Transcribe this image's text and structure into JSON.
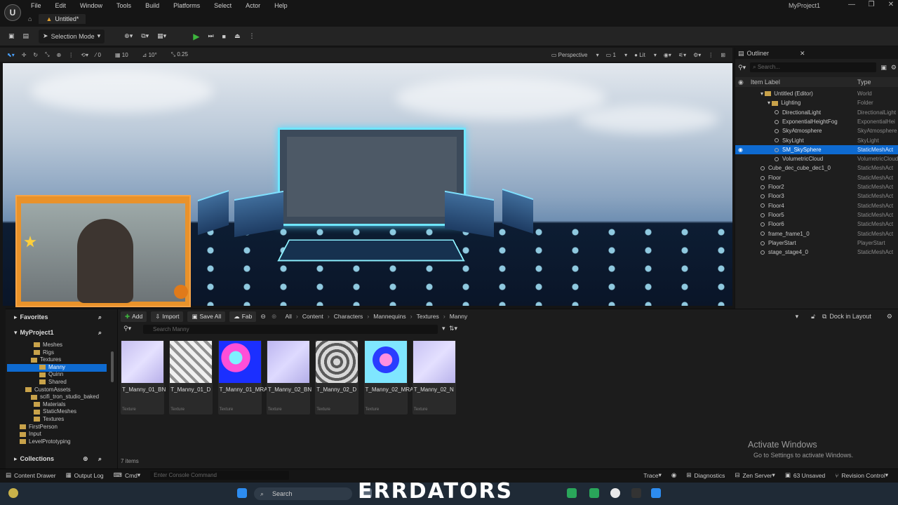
{
  "window": {
    "logo": "U",
    "project_name": "MyProject1",
    "doc_tab": "Untitled*",
    "controls": [
      "—",
      "❐",
      "✕"
    ]
  },
  "menu": [
    "File",
    "Edit",
    "Window",
    "Tools",
    "Build",
    "Platforms",
    "Select",
    "Actor",
    "Help"
  ],
  "toolbar": {
    "selection_mode": "Selection Mode"
  },
  "viewport_toolbar": {
    "snap_move": "10",
    "snap_rotate": "10°",
    "snap_scale": "0.25",
    "view_value": "0",
    "perspective": "Perspective",
    "view_count": "1",
    "lit": "Lit"
  },
  "outliner": {
    "tab": "Outliner",
    "search_placeholder": "Search...",
    "col_label": "Item Label",
    "col_type": "Type",
    "rows": [
      {
        "name": "Untitled (Editor)",
        "type": "World"
      },
      {
        "name": "Lighting",
        "type": "Folder"
      },
      {
        "name": "DirectionalLight",
        "type": "DirectionalLight"
      },
      {
        "name": "ExponentialHeightFog",
        "type": "ExponentialHei"
      },
      {
        "name": "SkyAtmosphere",
        "type": "SkyAtmosphere"
      },
      {
        "name": "SkyLight",
        "type": "SkyLight"
      },
      {
        "name": "SM_SkySphere",
        "type": "StaticMeshAct"
      },
      {
        "name": "VolumetricCloud",
        "type": "VolumetricCloud"
      },
      {
        "name": "Cube_dec_cube_dec1_0",
        "type": "StaticMeshAct"
      },
      {
        "name": "Floor",
        "type": "StaticMeshAct"
      },
      {
        "name": "Floor2",
        "type": "StaticMeshAct"
      },
      {
        "name": "Floor3",
        "type": "StaticMeshAct"
      },
      {
        "name": "Floor4",
        "type": "StaticMeshAct"
      },
      {
        "name": "Floor5",
        "type": "StaticMeshAct"
      },
      {
        "name": "Floor6",
        "type": "StaticMeshAct"
      },
      {
        "name": "frame_frame1_0",
        "type": "StaticMeshAct"
      },
      {
        "name": "PlayerStart",
        "type": "PlayerStart"
      },
      {
        "name": "stage_stage4_0",
        "type": "StaticMeshAct"
      }
    ]
  },
  "sources": {
    "favorites": "Favorites",
    "project": "MyProject1",
    "collections": "Collections",
    "tree": [
      "Meshes",
      "Rigs",
      "Textures",
      "Manny",
      "Quinn",
      "Shared",
      "CustomAssets",
      "scifi_tron_studio_baked",
      "Materials",
      "StaticMeshes",
      "Textures",
      "FirstPerson",
      "Input",
      "LevelPrototyping"
    ]
  },
  "content": {
    "add": "Add",
    "import": "Import",
    "save_all": "Save All",
    "fab": "Fab",
    "breadcrumbs": [
      "All",
      "Content",
      "Characters",
      "Mannequins",
      "Textures",
      "Manny"
    ],
    "dock": "Dock in Layout",
    "search_placeholder": "Search Manny",
    "asset_type": "Texture",
    "assets": [
      {
        "name": "T_Manny_01_BN"
      },
      {
        "name": "T_Manny_01_D"
      },
      {
        "name": "T_Manny_01_MRA"
      },
      {
        "name": "T_Manny_02_BN"
      },
      {
        "name": "T_Manny_02_D"
      },
      {
        "name": "T_Manny_02_MRA"
      },
      {
        "name": "T_Manny_02_N"
      }
    ],
    "items_count": "7 items"
  },
  "watermark": {
    "title": "Activate Windows",
    "subtitle": "Go to Settings to activate Windows."
  },
  "statusbar": {
    "content_drawer": "Content Drawer",
    "output_log": "Output Log",
    "cmd": "Cmd",
    "console_placeholder": "Enter Console Command",
    "trace": "Trace",
    "diagnostics": "Diagnostics",
    "zen_server": "Zen Server",
    "unsaved": "63 Unsaved",
    "revision": "Revision Control"
  },
  "taskbar": {
    "search": "Search",
    "overlay": "ERRDATORS"
  },
  "colors": {
    "selection": "#0e6ad0",
    "folder": "#c8a24a",
    "play": "#3db53d",
    "neon": "#6fe6ff"
  }
}
